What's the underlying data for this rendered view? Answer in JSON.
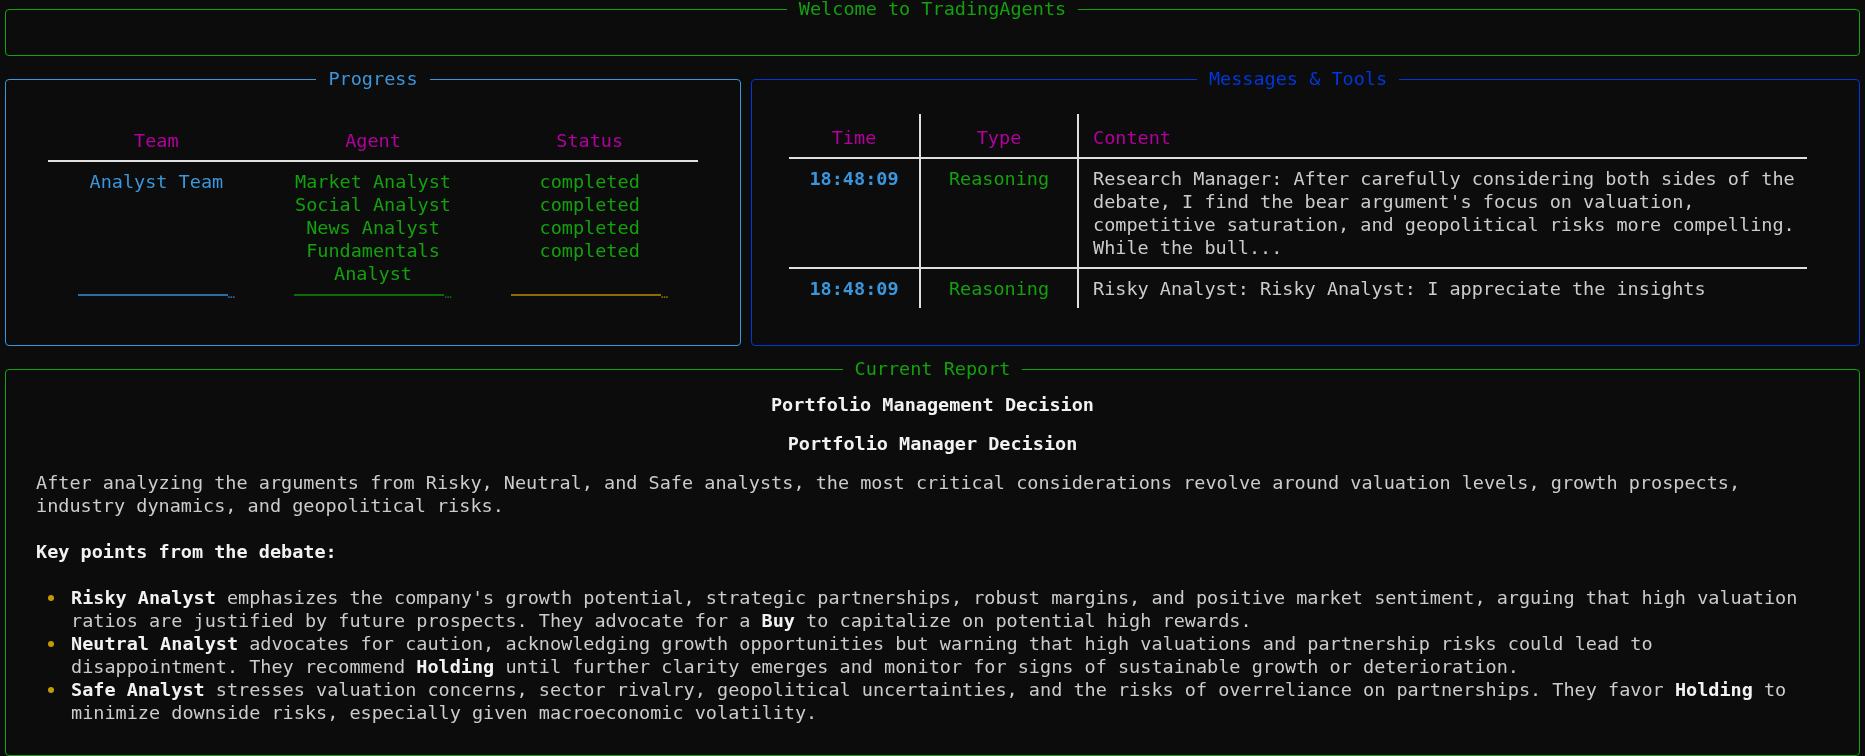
{
  "welcome_panel": {
    "title": "Welcome to TradingAgents"
  },
  "progress_panel": {
    "title": "Progress",
    "columns": [
      "Team",
      "Agent",
      "Status"
    ],
    "rows": [
      {
        "team": "Analyst Team",
        "agents": [
          "Market Analyst",
          "Social Analyst",
          "News Analyst",
          "Fundamentals Analyst"
        ],
        "statuses": [
          "completed",
          "completed",
          "completed",
          "completed"
        ]
      }
    ],
    "truncated_row": [
      "…",
      "…",
      "…"
    ]
  },
  "messages_panel": {
    "title": "Messages & Tools",
    "columns": [
      "Time",
      "Type",
      "Content"
    ],
    "rows": [
      {
        "time": "18:48:09",
        "type": "Reasoning",
        "content": "Research Manager: After carefully considering both sides of the debate, I find the bear argument's focus on valuation, competitive saturation, and geopolitical risks more compelling. While the bull..."
      },
      {
        "time": "18:48:09",
        "type": "Reasoning",
        "content": "Risky Analyst: Risky Analyst: I appreciate the insights"
      }
    ]
  },
  "report_panel": {
    "title": "Current Report",
    "heading": "Portfolio Management Decision",
    "subheading": "Portfolio Manager Decision",
    "intro": "After analyzing the arguments from Risky, Neutral, and Safe analysts, the most critical considerations revolve around valuation levels, growth prospects, industry dynamics, and geopolitical risks.",
    "key_points_label": "Key points from the debate:",
    "bullets": [
      "**Risky Analyst** emphasizes the company's growth potential, strategic partnerships, robust margins, and positive market sentiment, arguing that high valuation ratios are justified by future prospects. They advocate for a **Buy** to capitalize on potential high rewards.",
      "**Neutral Analyst** advocates for caution, acknowledging growth opportunities but warning that high valuations and partnership risks could lead to disappointment. They recommend **Holding** until further clarity emerges and monitor for signs of sustainable growth or deterioration.",
      "**Safe Analyst** stresses valuation concerns, sector rivalry, geopolitical uncertainties, and the risks of overreliance on partnerships. They favor **Holding** to minimize downside risks, especially given macroeconomic volatility."
    ]
  }
}
